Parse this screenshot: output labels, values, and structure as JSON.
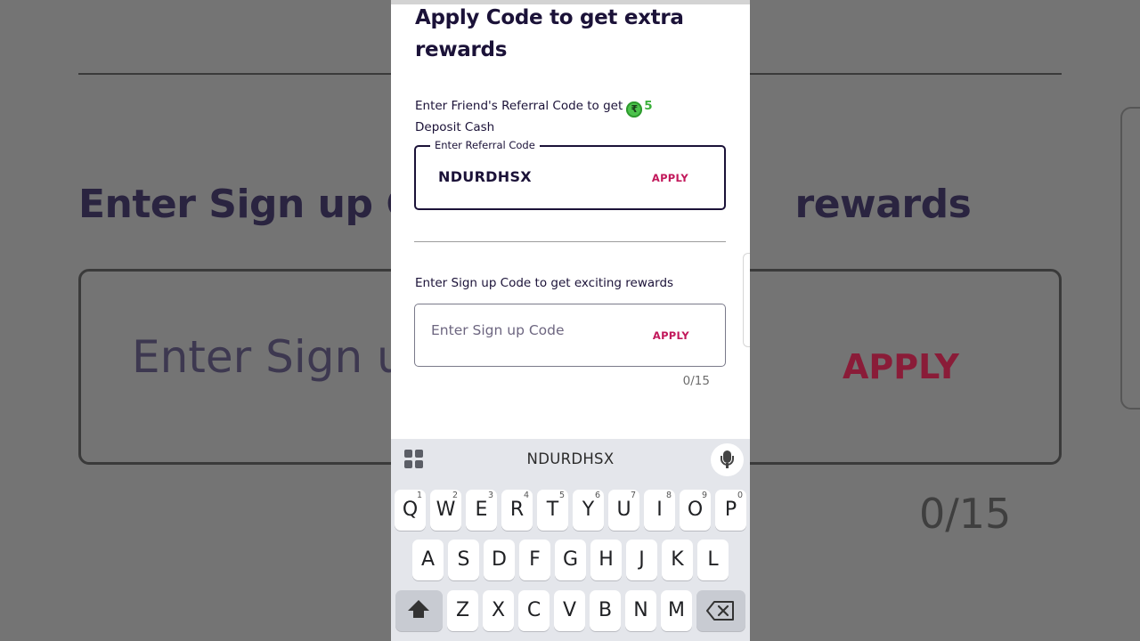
{
  "background": {
    "title_fragment_left": "Enter Sign up Co",
    "title_fragment_right": "rewards",
    "placeholder_fragment": "Enter Sign u",
    "apply": "APPLY",
    "counter": "0/15"
  },
  "page": {
    "title": "Apply Code to get extra rewards",
    "referral": {
      "label_prefix": "Enter Friend's Referral Code to get",
      "coin_symbol": "₹",
      "amount": "5",
      "label_suffix": "Deposit Cash",
      "field_label": "Enter Referral Code",
      "value": "NDURDHSX",
      "apply_label": "APPLY"
    },
    "signup": {
      "label": "Enter Sign up Code to get exciting rewards",
      "placeholder": "Enter Sign up Code",
      "apply_label": "APPLY",
      "counter": "0/15"
    }
  },
  "keyboard": {
    "suggestion": "NDURDHSX",
    "row1": [
      {
        "k": "Q",
        "n": "1"
      },
      {
        "k": "W",
        "n": "2"
      },
      {
        "k": "E",
        "n": "3"
      },
      {
        "k": "R",
        "n": "4"
      },
      {
        "k": "T",
        "n": "5"
      },
      {
        "k": "Y",
        "n": "6"
      },
      {
        "k": "U",
        "n": "7"
      },
      {
        "k": "I",
        "n": "8"
      },
      {
        "k": "O",
        "n": "9"
      },
      {
        "k": "P",
        "n": "0"
      }
    ],
    "row2": [
      "A",
      "S",
      "D",
      "F",
      "G",
      "H",
      "J",
      "K",
      "L"
    ],
    "row3": [
      "Z",
      "X",
      "C",
      "V",
      "B",
      "N",
      "M"
    ]
  }
}
